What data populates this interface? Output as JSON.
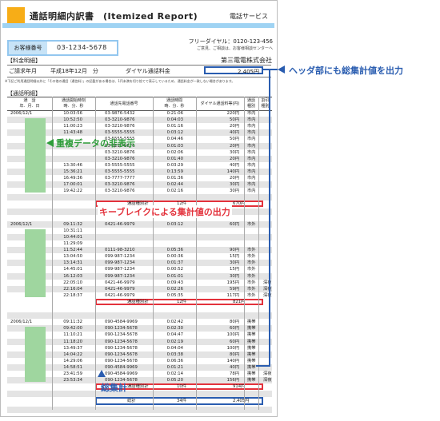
{
  "doc": {
    "title": "通話明細内訳書　(Itemized Report)",
    "service": "電話サービス",
    "customer_label": "お客様番号",
    "customer_number": "03-1234-5678",
    "free_dial": "フリーダイヤル：0120-123-456",
    "free_dial_note": "ご意見、ご相談は、お客様相談センターへ",
    "section_billing": "【料金明細】",
    "company": "第三電電株式会社",
    "billing_month_label": "ご請求年月",
    "billing_month": "平成18年12月　分",
    "dial_fee_label": "ダイヤル通話料金",
    "dial_fee_total": "2,405円",
    "notice": "※下記ご利用通話明細以外に「その他の通話（通信料）」の記載がある場合は、1円未満を切り捨てて表示しているため、通話料金が一致しない場合があります。",
    "section_calls": "【通話明細】"
  },
  "table": {
    "headers": {
      "date": "通　話",
      "date2": "年．月．日",
      "start": "通話開始時刻",
      "start2": "時．分．秒",
      "number": "通話先電話番号",
      "duration": "通話時間",
      "duration2": "時．分．秒",
      "fee": "ダイヤル通話料等(円)",
      "type": "通話",
      "type2": "種別",
      "band": "割引",
      "band2": "種別"
    },
    "group1": {
      "date": "2006/12/1",
      "rows": [
        {
          "time": "10:03:56",
          "number": "03-9876-5432",
          "dur": "0:21:06",
          "fee": "220円",
          "type": "市内",
          "band": ""
        },
        {
          "time": "10:52:50",
          "number": "03-3210-9876",
          "dur": "0:04:03",
          "fee": "50円",
          "type": "市内",
          "band": ""
        },
        {
          "time": "11:00:23",
          "number": "03-3210-9876",
          "dur": "0:01:16",
          "fee": "20円",
          "type": "市内",
          "band": ""
        },
        {
          "time": "11:43:48",
          "number": "03-5555-5555",
          "dur": "0:03:12",
          "fee": "40円",
          "type": "市内",
          "band": ""
        },
        {
          "time": "",
          "number": "03-5555-5555",
          "dur": "0:04:46",
          "fee": "50円",
          "type": "市内",
          "band": ""
        },
        {
          "time": "",
          "number": "03-3210-9876",
          "dur": "0:01:03",
          "fee": "20円",
          "type": "市内",
          "band": ""
        },
        {
          "time": "",
          "number": "03-3210-9876",
          "dur": "0:02:06",
          "fee": "30円",
          "type": "市内",
          "band": ""
        },
        {
          "time": "",
          "number": "03-3210-9876",
          "dur": "0:01:40",
          "fee": "20円",
          "type": "市内",
          "band": ""
        },
        {
          "time": "13:30:46",
          "number": "03-5555-5555",
          "dur": "0:03:29",
          "fee": "40円",
          "type": "市内",
          "band": ""
        },
        {
          "time": "15:36:21",
          "number": "03-5555-5555",
          "dur": "0:13:59",
          "fee": "140円",
          "type": "市内",
          "band": ""
        },
        {
          "time": "16:49:36",
          "number": "03-7777-7777",
          "dur": "0:01:36",
          "fee": "20円",
          "type": "市内",
          "band": ""
        },
        {
          "time": "17:00:01",
          "number": "03-3210-9876",
          "dur": "0:02:44",
          "fee": "30円",
          "type": "市内",
          "band": ""
        },
        {
          "time": "19:42:22",
          "number": "03-3210-9876",
          "dur": "0:02:16",
          "fee": "30円",
          "type": "市内",
          "band": ""
        }
      ],
      "subtotal_label": "通話種別計",
      "subtotal_count": "12件",
      "subtotal_amount": "670円"
    },
    "group2": {
      "date": "2006/12/1",
      "rows": [
        {
          "time": "09:11:32",
          "number": "0421-46-9979",
          "dur": "0:03:12",
          "fee": "60円",
          "type": "市外",
          "band": ""
        },
        {
          "time": "10:31:11",
          "number": "",
          "dur": "",
          "fee": "",
          "type": "",
          "band": ""
        },
        {
          "time": "10:44:01",
          "number": "",
          "dur": "",
          "fee": "",
          "type": "",
          "band": ""
        },
        {
          "time": "11:29:09",
          "number": "",
          "dur": "",
          "fee": "",
          "type": "",
          "band": ""
        },
        {
          "time": "11:52:44",
          "number": "0111-98-3210",
          "dur": "0:05:36",
          "fee": "90円",
          "type": "市外",
          "band": ""
        },
        {
          "time": "13:04:50",
          "number": "099-987-1234",
          "dur": "0:00:36",
          "fee": "15円",
          "type": "市外",
          "band": ""
        },
        {
          "time": "13:14:31",
          "number": "099-987-1234",
          "dur": "0:01:37",
          "fee": "30円",
          "type": "市外",
          "band": ""
        },
        {
          "time": "14:45:01",
          "number": "099-987-1234",
          "dur": "0:00:52",
          "fee": "15円",
          "type": "市外",
          "band": ""
        },
        {
          "time": "16:12:03",
          "number": "099-987-1234",
          "dur": "0:01:01",
          "fee": "30円",
          "type": "市外",
          "band": ""
        },
        {
          "time": "22:05:10",
          "number": "0421-46-9979",
          "dur": "0:09:43",
          "fee": "195円",
          "type": "市外",
          "band": "深夜"
        },
        {
          "time": "22:16:04",
          "number": "0421-46-9979",
          "dur": "0:02:26",
          "fee": "59円",
          "type": "市外",
          "band": "深夜"
        },
        {
          "time": "22:18:37",
          "number": "0421-46-9979",
          "dur": "0:05:35",
          "fee": "117円",
          "type": "市外",
          "band": "深夜"
        }
      ],
      "subtotal_label": "通話種別計",
      "subtotal_count": "12件",
      "subtotal_amount": "821円"
    },
    "group3": {
      "date": "2006/12/1",
      "rows": [
        {
          "time": "09:11:32",
          "number": "090-4584-9969",
          "dur": "0:02:42",
          "fee": "80円",
          "type": "携帯",
          "band": ""
        },
        {
          "time": "09:42:00",
          "number": "090-1234-5678",
          "dur": "0:02:30",
          "fee": "60円",
          "type": "携帯",
          "band": ""
        },
        {
          "time": "11:10:21",
          "number": "090-1234-5678",
          "dur": "0:04:47",
          "fee": "100円",
          "type": "携帯",
          "band": ""
        },
        {
          "time": "11:18:20",
          "number": "090-1234-5678",
          "dur": "0:02:19",
          "fee": "60円",
          "type": "携帯",
          "band": ""
        },
        {
          "time": "13:49:37",
          "number": "090-1234-5678",
          "dur": "0:04:04",
          "fee": "100円",
          "type": "携帯",
          "band": ""
        },
        {
          "time": "14:04:22",
          "number": "090-1234-5678",
          "dur": "0:03:38",
          "fee": "80円",
          "type": "携帯",
          "band": ""
        },
        {
          "time": "14:29:06",
          "number": "090-1234-5678",
          "dur": "0:06:36",
          "fee": "140円",
          "type": "携帯",
          "band": ""
        },
        {
          "time": "14:58:51",
          "number": "090-4584-9969",
          "dur": "0:01:21",
          "fee": "40円",
          "type": "携帯",
          "band": ""
        },
        {
          "time": "23:41:59",
          "number": "090-4584-9969",
          "dur": "0:02:14",
          "fee": "78円",
          "type": "携帯",
          "band": "深夜"
        },
        {
          "time": "23:53:34",
          "number": "090-1234-5678",
          "dur": "0:05:20",
          "fee": "156円",
          "type": "携帯",
          "band": "深夜"
        }
      ],
      "subtotal_label": "通話種別計",
      "subtotal_count": "10件",
      "subtotal_amount": "914円"
    },
    "grand": {
      "label": "総計",
      "count": "34件",
      "amount": "2,405円"
    }
  },
  "annotations": {
    "header_total": "ヘッダ部にも総集計値を出力",
    "hide_dup": "重複データの非表示",
    "keybreak": "キーブレイクによる集計値の出力",
    "grand_total": "総集計"
  },
  "colors": {
    "accent_blue": "#2a5db0",
    "accent_red": "#e3323c",
    "accent_green": "#2e9d3a",
    "title_orange": "#f7ad17",
    "light_blue": "#9fd3f3"
  }
}
